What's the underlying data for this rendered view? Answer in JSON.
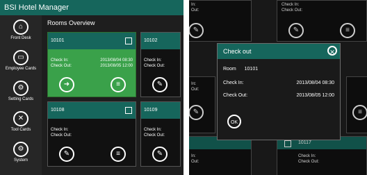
{
  "app": {
    "title": "BSI Hotel Manager"
  },
  "sidebar": {
    "items": [
      {
        "label": "Front Desk",
        "icon": "front-desk-icon",
        "glyph": "⌂"
      },
      {
        "label": "Employee Cards",
        "icon": "employee-card-icon",
        "glyph": "▭"
      },
      {
        "label": "Setting Cards",
        "icon": "setting-card-icon",
        "glyph": "⚙"
      },
      {
        "label": "Tool Cards",
        "icon": "tool-icon",
        "glyph": "✕"
      },
      {
        "label": "System",
        "icon": "system-gear-icon",
        "glyph": "⚙"
      }
    ]
  },
  "main": {
    "section_title": "Rooms Overview",
    "cards": [
      {
        "room": "10101",
        "check_in_label": "Check In:",
        "check_in_value": "2013/08/04 08:30",
        "check_out_label": "Check Out:",
        "check_out_value": "2013/08/05 12:00",
        "active": true
      },
      {
        "room": "10108",
        "check_in_label": "Check In:",
        "check_in_value": "",
        "check_out_label": "Check Out:",
        "check_out_value": "",
        "active": false
      }
    ],
    "side_cards": [
      {
        "room": "10102",
        "check_in_label": "Check In:",
        "check_out_label": "Check Out:"
      },
      {
        "room": "10109",
        "check_in_label": "Check In:",
        "check_out_label": "Check Out:"
      }
    ]
  },
  "right": {
    "top_left": {
      "in": "In:",
      "out": "Out:"
    },
    "top_right": {
      "check_in": "Check In:",
      "check_out": "Check Out:"
    },
    "mid_left": {
      "in": "Irc",
      "out": "Out:"
    },
    "bottom_left": {
      "in": "In:",
      "out": "Out:"
    },
    "bottom_right": {
      "room": "10117",
      "check_in": "Check In:",
      "check_out": "Check Out:"
    }
  },
  "dialog": {
    "title": "Check out",
    "room_label": "Room",
    "room_value": "10101",
    "check_in_label": "Check In:",
    "check_in_value": "2013/08/04 08:30",
    "check_out_label": "Check Out:",
    "check_out_value": "2013/08/05 12:00",
    "ok_label": "OK"
  },
  "colors": {
    "accent": "#16665c",
    "active_card": "#3aa14a",
    "background": "#1e1e1e"
  }
}
